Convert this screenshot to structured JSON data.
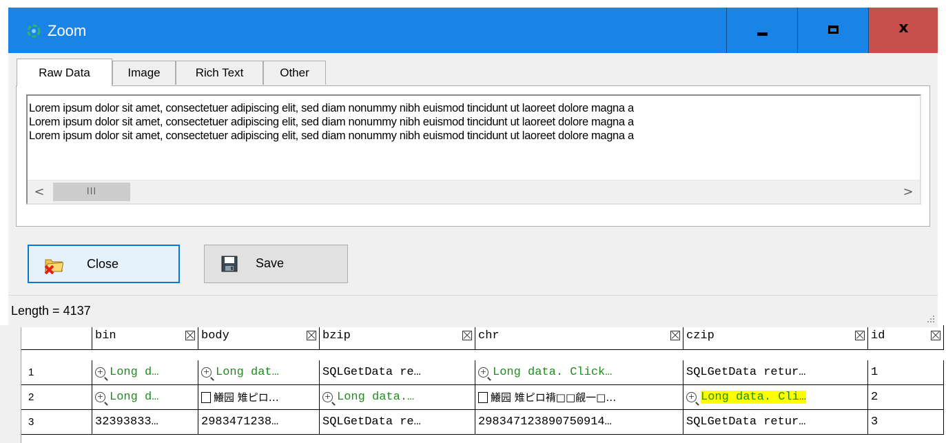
{
  "window": {
    "title": "Zoom",
    "minimize": "minimize",
    "maximize": "maximize",
    "close": "x"
  },
  "tabs": [
    {
      "label": "Raw Data",
      "active": true
    },
    {
      "label": "Image",
      "active": false
    },
    {
      "label": "Rich Text",
      "active": false
    },
    {
      "label": "Other",
      "active": false
    }
  ],
  "raw_text": {
    "lines": [
      "Lorem ipsum dolor sit amet, consectetuer adipiscing elit, sed diam nonummy nibh euismod tincidunt ut laoreet dolore magna a",
      "Lorem ipsum dolor sit amet, consectetuer adipiscing elit, sed diam nonummy nibh euismod tincidunt ut laoreet dolore magna a",
      "Lorem ipsum dolor sit amet, consectetuer adipiscing elit, sed diam nonummy nibh euismod tincidunt ut laoreet dolore magna a"
    ],
    "scroll_thumb_glyph": "III",
    "scroll_left": "<",
    "scroll_right": ">"
  },
  "buttons": {
    "close_label": "Close",
    "save_label": "Save"
  },
  "status": {
    "text": "Length = 4137"
  },
  "grid": {
    "columns": [
      "",
      "bin",
      "body",
      "bzip",
      "chr",
      "czip",
      "id"
    ],
    "rows": [
      {
        "num": "1",
        "bin": "Long d…",
        "body": "Long dat…",
        "bzip": "SQLGetData re…",
        "chr": "Long data. Click…",
        "czip": "SQLGetData retur…",
        "id": "1"
      },
      {
        "num": "2",
        "bin": "Long d…",
        "body": "鱶园 雉ピロ…",
        "bzip": "Long data.…",
        "chr": "鱶园 雉ピロ褙□□觎一□…",
        "czip": "Long data. Cli…",
        "id": "2"
      },
      {
        "num": "3",
        "bin": "32393833…",
        "body": "2983471238…",
        "bzip": "SQLGetData re…",
        "chr": "298347123890750914…",
        "czip": "SQLGetData retur…",
        "id": "3"
      }
    ]
  },
  "colors": {
    "titlebar": "#1a84e6",
    "close_button": "#c8504c",
    "long_data_text": "#1a8f1a",
    "highlight": "#ffff00"
  }
}
